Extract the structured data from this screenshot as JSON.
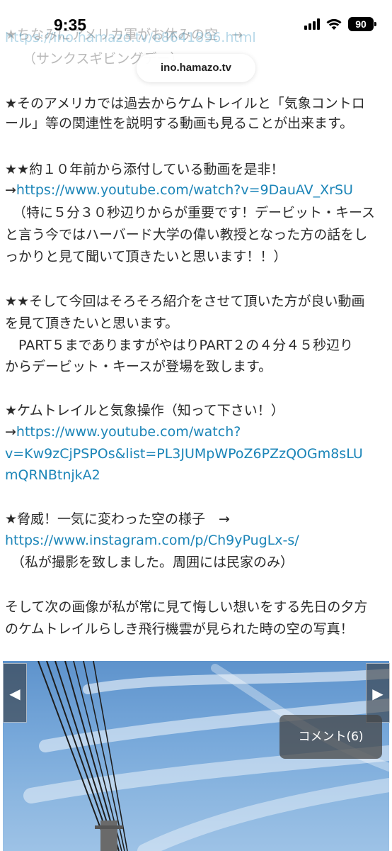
{
  "status_bar": {
    "time": "9:35",
    "battery": "90",
    "signal_icon": "signal-bars-icon",
    "wifi_icon": "wifi-icon",
    "battery_icon": "battery-icon"
  },
  "browser": {
    "url": "ino.hamazo.tv"
  },
  "article": {
    "header_line": "★ちなみにアメリカ軍がお休みの空　→",
    "header_link": "https://ino.hamazo.tv/e8641896.html",
    "header_note": "（サンクスギビングデー）",
    "p1_l1": "★そのアメリカでは過去からケムトレイルと「気象コントロ",
    "p1_l2": "ール」等の関連性を説明する動画も見ることが出来ます。",
    "p2_l1": "★★約１０年前から添付している動画を是非！",
    "p2_arrow": "→",
    "p2_link": "https://www.youtube.com/watch?v=9DauAV_XrSU",
    "p2_l3": "（特に５分３０秒辺りからが重要です！デービット・キース",
    "p2_l4": "と言う今ではハーバード大学の偉い教授となった方の話をし",
    "p2_l5": "っかりと見て聞いて頂きたいと思います！！）",
    "p3_l1": "★★そして今回はそろそろ紹介をさせて頂いた方が良い動画",
    "p3_l2": "を見て頂きたいと思います。",
    "p3_l3": "　PART５までありますがやはりPART２の４分４５秒辺り",
    "p3_l4": "からデービット・キースが登場を致します。",
    "p4_l1": "★ケムトレイルと気象操作（知って下さい！）",
    "p4_arrow": "→",
    "p4_link_l1": "https://www.youtube.com/watch?",
    "p4_link_l2": "v=Kw9zCjPSPOs&list=PL3JUMpWPoZ6PZzQOGm8sLU",
    "p4_link_l3": "mQRNBtnjkA2",
    "p5_l1": "★脅威！一気に変わった空の様子　→",
    "p5_link": "https://www.instagram.com/p/Ch9yPugLx-s/",
    "p5_note": "（私が撮影を致しました。周囲には民家のみ）",
    "p6_l1": "そして次の画像が私が常に見て悔しい想いをする先日の夕方",
    "p6_l2": "のケムトレイルらしき飛行機雲が見られた時の空の写真！"
  },
  "gallery": {
    "prev_icon": "chevron-left-icon",
    "next_icon": "chevron-right-icon",
    "comment_button": "コメント(6)"
  }
}
